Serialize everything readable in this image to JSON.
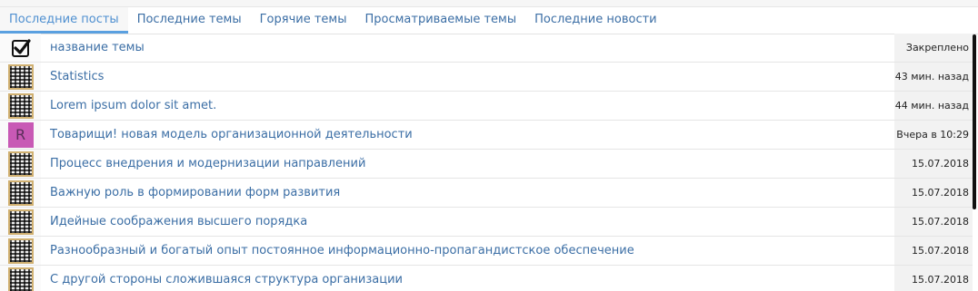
{
  "tabs": [
    {
      "label": "Последние посты",
      "active": true
    },
    {
      "label": "Последние темы",
      "active": false
    },
    {
      "label": "Горячие темы",
      "active": false
    },
    {
      "label": "Просматриваемые темы",
      "active": false
    },
    {
      "label": "Последние новости",
      "active": false
    }
  ],
  "rows": [
    {
      "icon": "checkbox-checked-icon",
      "title": "название темы",
      "meta": "Закреплено"
    },
    {
      "icon": "qr-avatar",
      "title": "Statistics",
      "meta": "43 мин. назад"
    },
    {
      "icon": "qr-avatar",
      "title": "Lorem ipsum dolor sit amet.",
      "meta": "44 мин. назад"
    },
    {
      "icon": "letter-avatar",
      "avatar_letter": "R",
      "avatar_color": "#c859b5",
      "title": "Товарищи! новая модель организационной деятельности",
      "meta": "Вчера в 10:29"
    },
    {
      "icon": "qr-avatar",
      "title": "Процесс внедрения и модернизации направлений",
      "meta": "15.07.2018"
    },
    {
      "icon": "qr-avatar",
      "title": "Важную роль в формировании форм развития",
      "meta": "15.07.2018"
    },
    {
      "icon": "qr-avatar",
      "title": "Идейные соображения высшего порядка",
      "meta": "15.07.2018"
    },
    {
      "icon": "qr-avatar",
      "title": "Разнообразный и богатый опыт постоянное информационно-пропагандистское обеспечение",
      "meta": "15.07.2018"
    },
    {
      "icon": "qr-avatar",
      "title": "С другой стороны сложившаяся структура организации",
      "meta": "15.07.2018"
    }
  ],
  "colors": {
    "link": "#3b6ea5",
    "active_tab": "#4e8fd0",
    "tab_underline": "#5aa0e0"
  }
}
